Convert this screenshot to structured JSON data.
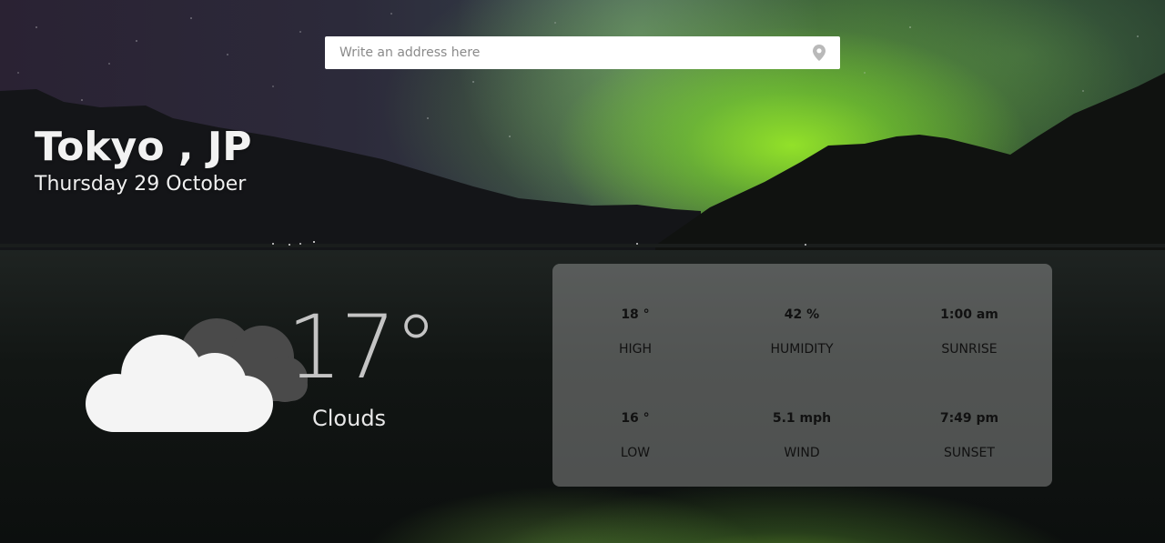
{
  "search": {
    "placeholder": "Write an address here",
    "value": "",
    "icon": "map-pin-icon"
  },
  "location": {
    "city": "Tokyo , JP",
    "date": "Thursday 29 October"
  },
  "current": {
    "icon": "clouds-icon",
    "temperature": "17°",
    "condition": "Clouds"
  },
  "stats": {
    "high": {
      "value": "18 °",
      "label": "HIGH"
    },
    "humidity": {
      "value": "42 %",
      "label": "HUMIDITY"
    },
    "sunrise": {
      "value": "1:00 am",
      "label": "SUNRISE"
    },
    "low": {
      "value": "16 °",
      "label": "LOW"
    },
    "wind": {
      "value": "5.1 mph",
      "label": "WIND"
    },
    "sunset": {
      "value": "7:49 pm",
      "label": "SUNSET"
    }
  },
  "colors": {
    "aurora": "#8fd62e",
    "panel": "#c8c8c8",
    "text_light": "#f2f2f2",
    "text_dark": "#111111"
  }
}
